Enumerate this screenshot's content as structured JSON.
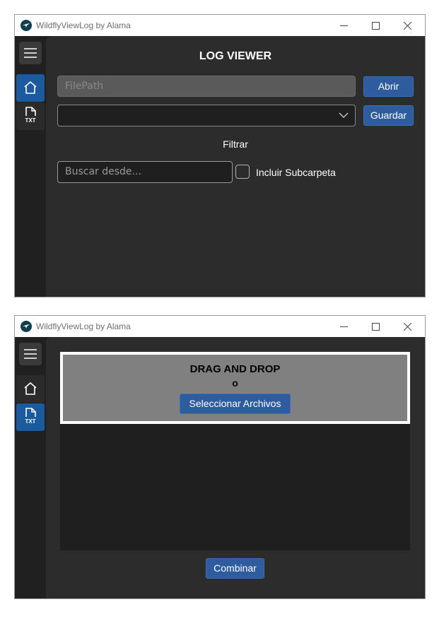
{
  "app": {
    "title": "WildflyViewLog by Alama",
    "accent_color": "#2e5c9f",
    "active_nav_color": "#1b5a9c"
  },
  "window_controls": {
    "icons": [
      "minimize-icon",
      "maximize-icon",
      "close-icon"
    ]
  },
  "sidebar": {
    "menu_icon": "hamburger-menu-icon",
    "items": [
      {
        "icon": "home-icon",
        "label": ""
      },
      {
        "icon": "txt-file-icon",
        "label": "TXT"
      }
    ]
  },
  "log_viewer": {
    "title": "LOG VIEWER",
    "filepath_placeholder": "FilePath",
    "open_button": "Abrir",
    "save_button": "Guardar",
    "selected_option": "",
    "filter_label": "Filtrar",
    "search_placeholder": "Buscar desde...",
    "include_subfolder_label": "Incluir Subcarpeta",
    "include_subfolder_checked": false
  },
  "merge_view": {
    "drop_title": "DRAG AND DROP",
    "drop_or": "o",
    "select_files_button": "Seleccionar Archivos",
    "combine_button": "Combinar"
  }
}
